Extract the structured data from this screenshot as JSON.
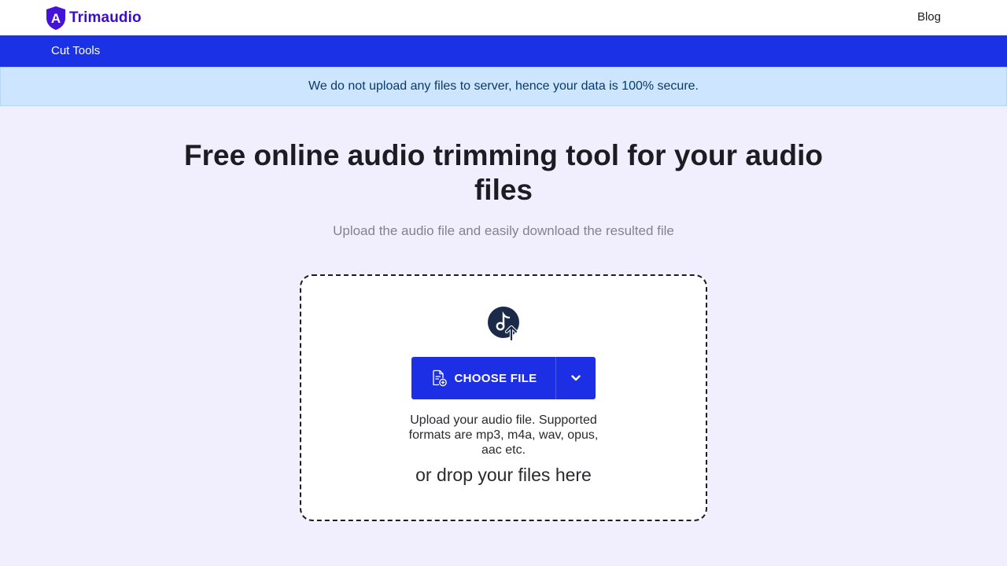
{
  "header": {
    "logo_letter": "A",
    "logo_text": "Trimaudio",
    "blog_label": "Blog"
  },
  "nav": {
    "items": [
      {
        "label": "Cut Tools"
      }
    ]
  },
  "alert": {
    "text": "We do not upload any files to server, hence your data is 100% secure."
  },
  "hero": {
    "title": "Free online audio trimming tool for your audio files",
    "subtitle": "Upload the audio file and easily download the resulted file"
  },
  "uploader": {
    "choose_label": "CHOOSE FILE",
    "help_text": "Upload your audio file. Supported formats are mp3, m4a, wav, opus, aac etc.",
    "drop_text": "or drop your files here",
    "icons": {
      "main": "music-upload-icon",
      "file": "file-add-icon",
      "dropdown": "chevron-down-icon"
    }
  },
  "colors": {
    "brand_purple": "#3b0fc9",
    "nav_blue": "#1a31e6",
    "button_blue": "#1c2fe4",
    "alert_bg": "#cde5fe",
    "page_bg": "#f1effd"
  }
}
